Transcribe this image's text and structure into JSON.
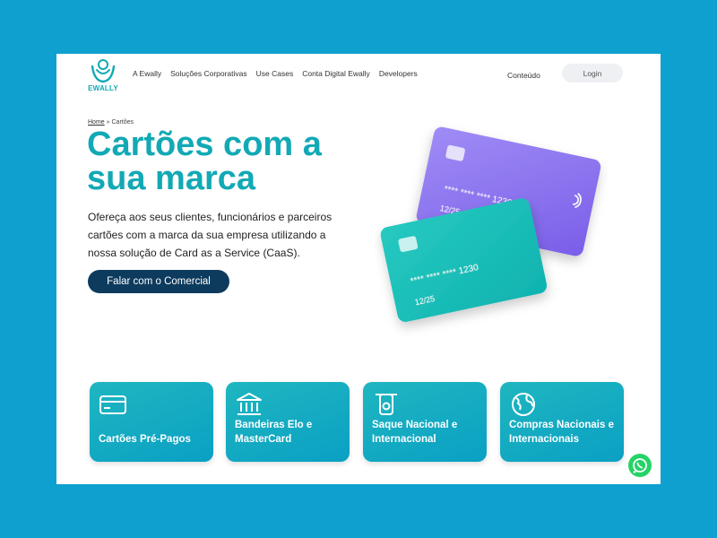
{
  "header": {
    "logo_text": "EWALLY",
    "nav": [
      "A Ewally",
      "Soluções Corporativas",
      "Use Cases",
      "Conta Digital Ewally",
      "Developers"
    ],
    "conteudo": "Conteúdo",
    "login": "Login"
  },
  "breadcrumb": {
    "home": "Home",
    "separator": "»",
    "current": "Cartões"
  },
  "hero": {
    "title": "Cartões com a sua marca",
    "description": "Ofereça aos seus clientes, funcionários e parceiros cartões com a marca da sua empresa utilizando a nossa solução de Card as a Service (CaaS).",
    "cta": "Falar com o Comercial"
  },
  "cards_art": {
    "purple_number": "**** **** **** 1230",
    "purple_expiry": "12/25",
    "teal_number": "**** **** **** 1230",
    "teal_expiry": "12/25"
  },
  "features": [
    {
      "label": "Cartões Pré-Pagos",
      "icon": "credit-card-icon"
    },
    {
      "label": "Bandeiras Elo e MasterCard",
      "icon": "bank-icon"
    },
    {
      "label": "Saque Nacional e Internacional",
      "icon": "withdraw-icon"
    },
    {
      "label": "Compras Nacionais e Internacionais",
      "icon": "globe-icon"
    }
  ],
  "colors": {
    "background": "#0ea0cf",
    "brand_teal": "#12a9b5",
    "cta_navy": "#0d3b5e",
    "card_purple": "#8b6ff0",
    "card_teal": "#1ec2bb",
    "whatsapp": "#25d366"
  }
}
